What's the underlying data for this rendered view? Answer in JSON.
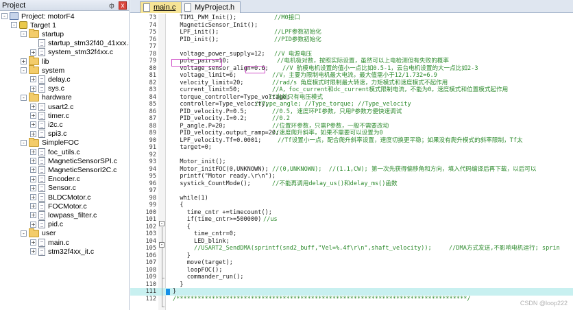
{
  "project_pane": {
    "title": "Project",
    "pin_glyph": "ф",
    "close_glyph": "x",
    "tree": [
      {
        "label": "Project: motorF4",
        "kind": "project",
        "expander": "-"
      },
      {
        "label": "Target 1",
        "kind": "target",
        "expander": "-"
      },
      {
        "label": "startup",
        "kind": "folder",
        "expander": "-"
      },
      {
        "label": "startup_stm32f40_41xxx.s",
        "kind": "file",
        "expander": ""
      },
      {
        "label": "system_stm32f4xx.c",
        "kind": "file",
        "expander": "+"
      },
      {
        "label": "lib",
        "kind": "folder",
        "expander": "+"
      },
      {
        "label": "system",
        "kind": "folder",
        "expander": "-"
      },
      {
        "label": "delay.c",
        "kind": "file",
        "expander": "+"
      },
      {
        "label": "sys.c",
        "kind": "file",
        "expander": "+"
      },
      {
        "label": "hardware",
        "kind": "folder",
        "expander": "-"
      },
      {
        "label": "usart2.c",
        "kind": "file",
        "expander": "+"
      },
      {
        "label": "timer.c",
        "kind": "file",
        "expander": "+"
      },
      {
        "label": "i2c.c",
        "kind": "file",
        "expander": "+"
      },
      {
        "label": "spi3.c",
        "kind": "file",
        "expander": "+"
      },
      {
        "label": "SimpleFOC",
        "kind": "folder",
        "expander": "-"
      },
      {
        "label": "foc_utils.c",
        "kind": "file",
        "expander": "+"
      },
      {
        "label": "MagneticSensorSPI.c",
        "kind": "file",
        "expander": "+"
      },
      {
        "label": "MagneticSensorI2C.c",
        "kind": "file",
        "expander": "+"
      },
      {
        "label": "Encoder.c",
        "kind": "file",
        "expander": "+"
      },
      {
        "label": "Sensor.c",
        "kind": "file",
        "expander": "+"
      },
      {
        "label": "BLDCMotor.c",
        "kind": "file",
        "expander": "+"
      },
      {
        "label": "FOCMotor.c",
        "kind": "file",
        "expander": "+"
      },
      {
        "label": "lowpass_filter.c",
        "kind": "file",
        "expander": "+"
      },
      {
        "label": "pid.c",
        "kind": "file",
        "expander": "+"
      },
      {
        "label": "user",
        "kind": "folder",
        "expander": "-"
      },
      {
        "label": "main.c",
        "kind": "file",
        "expander": "+"
      },
      {
        "label": "stm32f4xx_it.c",
        "kind": "file",
        "expander": "+"
      }
    ]
  },
  "tabs": [
    {
      "label": "main.c",
      "active": true
    },
    {
      "label": "MyProject.h",
      "active": false
    }
  ],
  "code_lines": [
    {
      "n": "73",
      "code": "  TIM1_PWM_Init();",
      "cmt": "//M0接口"
    },
    {
      "n": "74",
      "code": "  MagneticSensor_Init();",
      "cmt": ""
    },
    {
      "n": "75",
      "code": "  LPF_init();",
      "cmt": "//LPF参数初始化"
    },
    {
      "n": "76",
      "code": "  PID_init();",
      "cmt": "//PID参数初始化"
    },
    {
      "n": "77",
      "code": "",
      "cmt": ""
    },
    {
      "n": "78",
      "code": "  voltage_power_supply=12;",
      "cmt": "//V 电源电压"
    },
    {
      "n": "79",
      "code": "  pole_pairs=10;",
      "cmt": "//电机极对数，按照实际设置，虽然可以上电检测但有失败的概率"
    },
    {
      "n": "80",
      "code": "  voltage_sensor_align=0.6;",
      "cmt": "//V 航模电机设置的值小一点比如0.5-1，云台电机设置的大一点比如2-3"
    },
    {
      "n": "81",
      "code": "  voltage_limit=6;",
      "cmt": "//V，主要为限制电机最大电流，最大值需小于12/1.732=6.9"
    },
    {
      "n": "82",
      "code": "  velocity_limit=20;",
      "cmt": "//rad/s 角度模式时限制最大转速，力矩模式和速度模式不起作用"
    },
    {
      "n": "83",
      "code": "  current_limit=50;",
      "cmt": "//A，foc_current和dc_current模式限制电流，不能为0。速度模式和位置模式起作用"
    },
    {
      "n": "84",
      "code": "  torque_controller=Type_voltage;",
      "cmt": "//当前只有电压模式"
    },
    {
      "n": "85",
      "code": "  controller=Type_velocity;",
      "cmt": "//Type_angle; //Type_torque; //Type_velocity"
    },
    {
      "n": "86",
      "code": "  PID_velocity.P=0.5;",
      "cmt": "//0.5, 速度环PI参数，只用P参数方便快速调试"
    },
    {
      "n": "87",
      "code": "  PID_velocity.I=0.2;",
      "cmt": "//0.2"
    },
    {
      "n": "88",
      "code": "  P_angle.P=20;",
      "cmt": "//位置环参数，只需P参数，一般不需要改动"
    },
    {
      "n": "89",
      "code": "  PID_velocity.output_ramp=20;",
      "cmt": "//速度爬升斜率，如果不需要可以设置为0"
    },
    {
      "n": "90",
      "code": "  LPF_velocity.Tf=0.0001;",
      "cmt": "//Tf设置小一点，配合爬升斜率设置，速度切换更平稳；如果没有爬升模式的斜率限制，Tf太"
    },
    {
      "n": "91",
      "code": "  target=0;",
      "cmt": ""
    },
    {
      "n": "92",
      "code": "",
      "cmt": ""
    },
    {
      "n": "93",
      "code": "  Motor_init();",
      "cmt": ""
    },
    {
      "n": "94",
      "code": "  Motor_initFOC(0,UNKNOWN);",
      "cmt": "//(0,UNKNOWN);  //(1.1,CW); 第一次先获得偏移角和方向，填入代码编译后再下载，以后可以"
    },
    {
      "n": "95",
      "code": "  printf(\"Motor ready.\\r\\n\");",
      "cmt": ""
    },
    {
      "n": "96",
      "code": "  systick_CountMode();",
      "cmt": "//不能再调用delay_us()和delay_ms()函数"
    },
    {
      "n": "97",
      "code": "",
      "cmt": ""
    },
    {
      "n": "98",
      "code": "  while(1)",
      "cmt": ""
    },
    {
      "n": "99",
      "code": "  {",
      "cmt": ""
    },
    {
      "n": "100",
      "code": "    time_cntr +=timecount();",
      "cmt": ""
    },
    {
      "n": "101",
      "code": "    if(time_cntr>=500000)",
      "cmt": "//us"
    },
    {
      "n": "102",
      "code": "    {",
      "cmt": ""
    },
    {
      "n": "103",
      "code": "      time_cntr=0;",
      "cmt": ""
    },
    {
      "n": "104",
      "code": "      LED_blink;",
      "cmt": ""
    },
    {
      "n": "105",
      "code": "      //USART2_SendDMA(sprintf(snd2_buff,\"Vel=%.4f\\r\\n\",shaft_velocity));",
      "cmt": "//DMA方式发送,不影响电机运行; sprin"
    },
    {
      "n": "106",
      "code": "    }",
      "cmt": ""
    },
    {
      "n": "107",
      "code": "    move(target);",
      "cmt": ""
    },
    {
      "n": "108",
      "code": "    loopFOC();",
      "cmt": ""
    },
    {
      "n": "109",
      "code": "    commander_run();",
      "cmt": ""
    },
    {
      "n": "110",
      "code": "  }",
      "cmt": ""
    },
    {
      "n": "111",
      "code": "}",
      "cmt": ""
    },
    {
      "n": "112",
      "code": "/**********************************************************************************/",
      "cmt": ""
    }
  ],
  "watermark": "CSDN @loop222"
}
